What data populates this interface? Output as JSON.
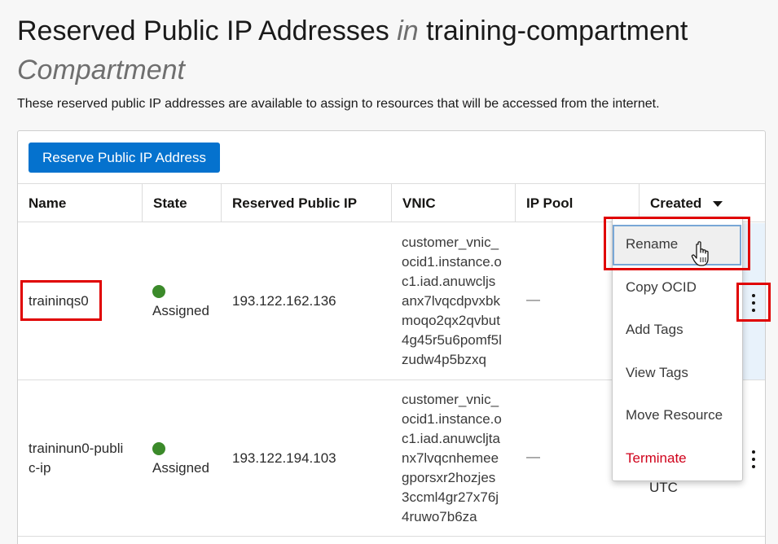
{
  "header": {
    "title_main": "Reserved Public IP Addresses",
    "title_in": "in",
    "title_compartment": "training-compartment",
    "title_compartment_word": "Compartment",
    "description": "These reserved public IP addresses are available to assign to resources that will be accessed from the internet."
  },
  "toolbar": {
    "reserve_button": "Reserve Public IP Address"
  },
  "table": {
    "columns": [
      "Name",
      "State",
      "Reserved Public IP",
      "VNIC",
      "IP Pool",
      "Created"
    ],
    "rows": [
      {
        "name": "traininqs0",
        "state": "Assigned",
        "ip": "193.122.162.136",
        "vnic_lines": [
          "customer_vnic_",
          "ocid1.instance.o",
          "c1.iad.anuwcljs",
          "anx7lvqcdpvxbk",
          "moqo2qx2qvbut",
          "4g45r5u6pomf5l",
          "zudw4p5bzxq"
        ],
        "ip_pool": "—",
        "created": ""
      },
      {
        "name_lines": [
          "traininun0-publi",
          "c-ip"
        ],
        "state": "Assigned",
        "ip": "193.122.194.103",
        "vnic_lines": [
          "customer_vnic_",
          "ocid1.instance.o",
          "c1.iad.anuwcljta",
          "nx7lvqcnhemee",
          "gporsxr2hozjes",
          "3ccml4gr27x76j",
          "4ruwo7b6za"
        ],
        "ip_pool": "—",
        "created": "UTC"
      }
    ]
  },
  "actions_menu": {
    "items": [
      "Rename",
      "Copy OCID",
      "Add Tags",
      "View Tags",
      "Move Resource",
      "Terminate"
    ]
  },
  "colors": {
    "primary": "#0572ce",
    "status_green": "#3b8a2a",
    "danger": "#d0021b",
    "highlight_red": "#e00000"
  },
  "icons": [
    "sort-down-icon",
    "status-dot-icon",
    "kebab-menu-icon",
    "hand-cursor-icon"
  ]
}
